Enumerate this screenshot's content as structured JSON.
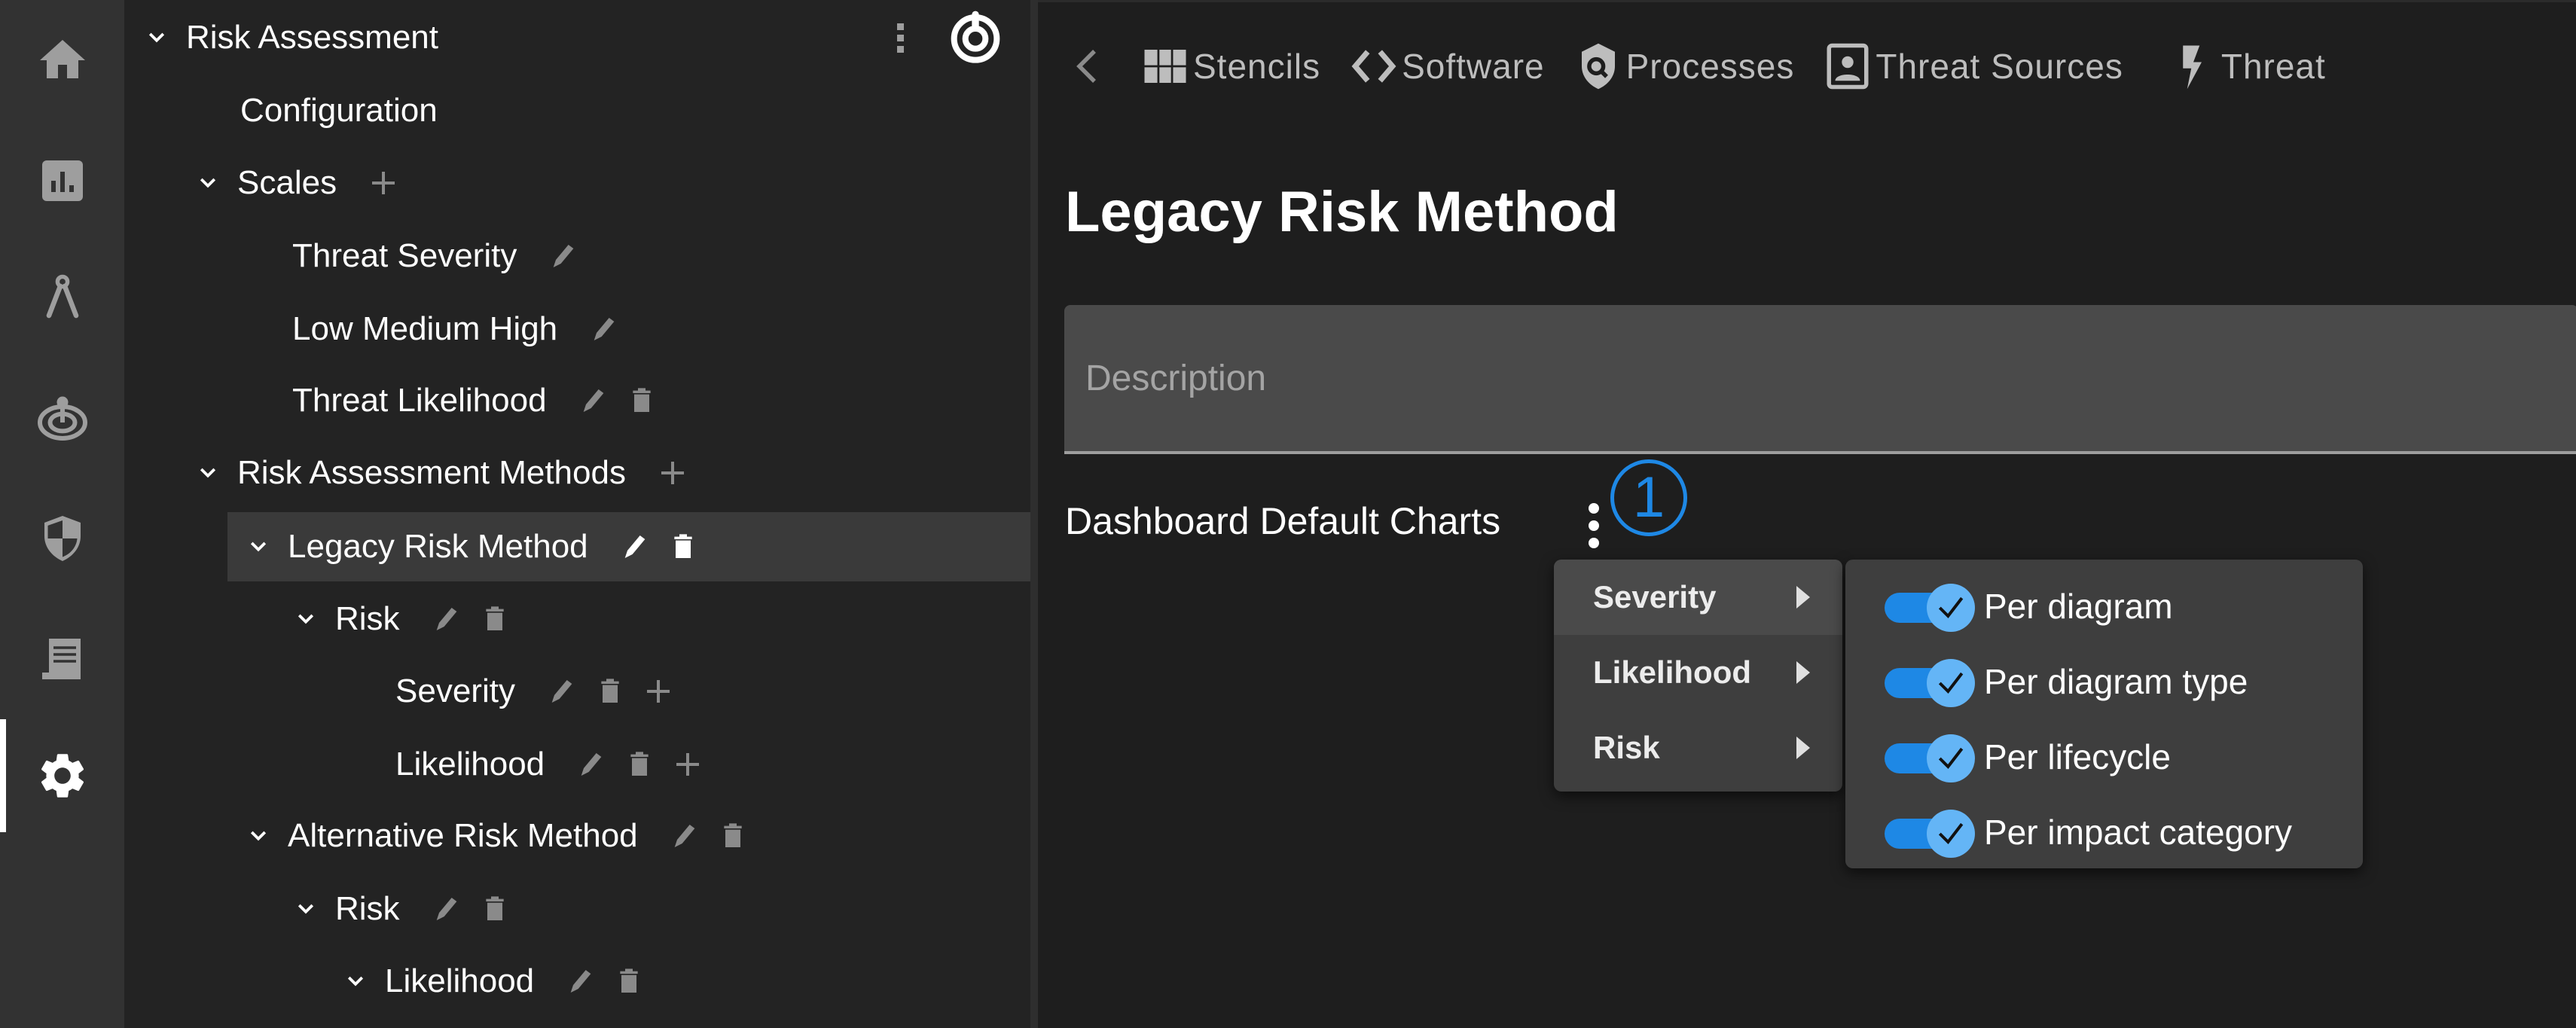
{
  "rail": {
    "items": [
      {
        "name": "home",
        "icon": "home-icon",
        "active": false
      },
      {
        "name": "dashboard",
        "icon": "bar-chart-icon",
        "active": false
      },
      {
        "name": "diagram",
        "icon": "compass-icon",
        "active": false
      },
      {
        "name": "threats",
        "icon": "target-icon",
        "active": false
      },
      {
        "name": "security",
        "icon": "shield-icon",
        "active": false
      },
      {
        "name": "reports",
        "icon": "document-icon",
        "active": false
      },
      {
        "name": "settings",
        "icon": "gear-icon",
        "active": true
      }
    ]
  },
  "tree": {
    "root": {
      "label": "Risk Assessment"
    },
    "configuration": {
      "label": "Configuration"
    },
    "scales": {
      "label": "Scales",
      "items": [
        {
          "label": "Threat Severity"
        },
        {
          "label": "Low Medium High"
        },
        {
          "label": "Threat Likelihood"
        }
      ]
    },
    "methods": {
      "label": "Risk Assessment Methods",
      "legacy": {
        "label": "Legacy Risk Method",
        "risk": {
          "label": "Risk",
          "severity": "Severity",
          "likelihood": "Likelihood"
        }
      },
      "alternative": {
        "label": "Alternative Risk Method",
        "risk": {
          "label": "Risk",
          "likelihood": "Likelihood"
        }
      }
    }
  },
  "tabs": [
    {
      "label": "Stencils",
      "icon": "grid-icon"
    },
    {
      "label": "Software",
      "icon": "code-icon"
    },
    {
      "label": "Processes",
      "icon": "shield-search-icon"
    },
    {
      "label": "Threat Sources",
      "icon": "person-badge-icon"
    },
    {
      "label": "Threat",
      "icon": "lightning-icon"
    }
  ],
  "page": {
    "title": "Legacy Risk Method",
    "description": {
      "value": "",
      "placeholder": "Description"
    },
    "dashboard_label": "Dashboard Default Charts",
    "annotation": "1"
  },
  "chart_menu": {
    "categories": [
      {
        "label": "Severity",
        "active": true
      },
      {
        "label": "Likelihood",
        "active": false
      },
      {
        "label": "Risk",
        "active": false
      }
    ],
    "options": [
      {
        "label": "Per diagram",
        "enabled": true
      },
      {
        "label": "Per diagram type",
        "enabled": true
      },
      {
        "label": "Per lifecycle",
        "enabled": true
      },
      {
        "label": "Per impact category",
        "enabled": true
      }
    ]
  },
  "colors": {
    "accent": "#1e88e5",
    "toggle_knob": "#64b5f6",
    "rail_bg": "#323232",
    "tree_bg": "#232323",
    "main_bg": "#1e1e1e",
    "selected_row": "#3a3a3a",
    "menu_bg": "#3e3e3e"
  }
}
